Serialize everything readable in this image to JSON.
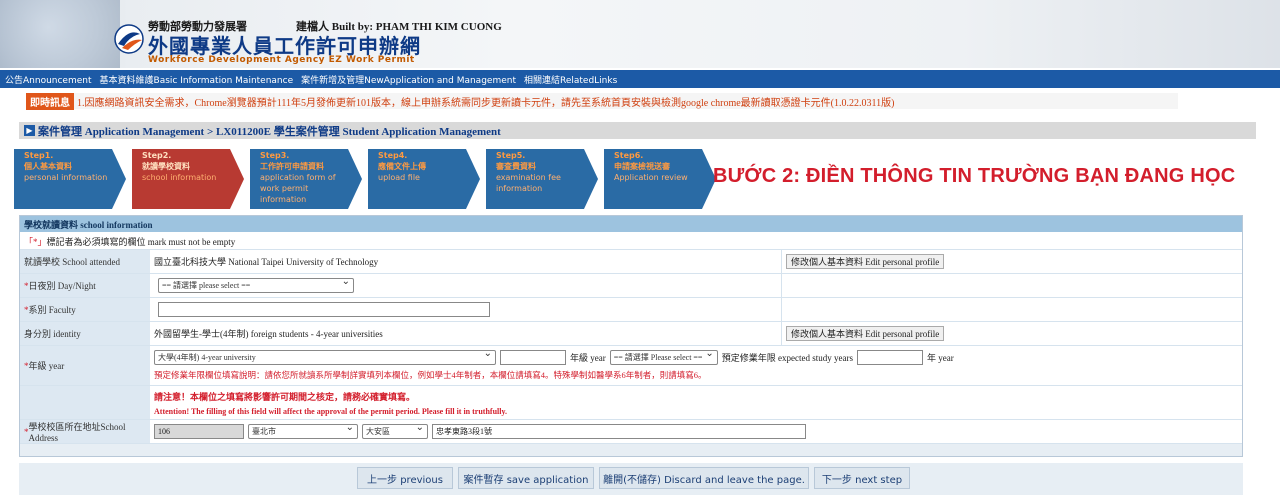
{
  "header": {
    "agency": "勞動部勞動力發展署",
    "builder": "建檔人 Built by: PHAM THI KIM CUONG",
    "title": "外國專業人員工作許可申辦網",
    "subtitle": "Workforce Development Agency EZ Work Permit"
  },
  "nav": {
    "items": [
      "公告Announcement",
      "基本資料維護Basic Information Maintenance",
      "案件新增及管理NewApplication and Management",
      "相關連結RelatedLinks"
    ]
  },
  "notice": {
    "badge": "即時訊息",
    "text": "1.因應網路資訊安全需求，Chrome瀏覽器預計111年5月發佈更新101版本，線上申辦系統需同步更新讀卡元件，請先至系統首頁安裝與檢測google chrome最新讀取憑證卡元件(1.0.22.0311版)"
  },
  "breadcrumb": "案件管理 Application Management > LX011200E 學生案件管理 Student Application Management",
  "steps": [
    {
      "num": "Step1.",
      "zh": "個人基本資料",
      "en": "personal information"
    },
    {
      "num": "Step2.",
      "zh": "就讀學校資料",
      "en": "school information"
    },
    {
      "num": "Step3.",
      "zh": "工作許可申請資料",
      "en": "application form of work permit information"
    },
    {
      "num": "Step4.",
      "zh": "應備文件上傳",
      "en": "upload file"
    },
    {
      "num": "Step5.",
      "zh": "審查費資料",
      "en": "examination fee information"
    },
    {
      "num": "Step6.",
      "zh": "申請案檢視送審",
      "en": "Application review"
    }
  ],
  "overlay_label": "BƯỚC 2: ĐIỀN THÔNG TIN TRƯỜNG BẠN ĐANG HỌC",
  "form": {
    "header": "學校就讀資料 school information",
    "hint_mark": "「*」",
    "hint": "標記者為必須填寫的欄位 mark must not be empty",
    "school_label": "就讀學校 School attended",
    "school_value": "國立臺北科技大學 National Taipei University of Technology",
    "edit_profile": "修改個人基本資料 Edit personal profile",
    "daynight_label": "日夜別 Day/Night",
    "daynight_select": "== 請選擇 please select ==",
    "faculty_label": "系別 Faculty",
    "faculty_value": "",
    "identity_label": "身分別 identity",
    "identity_value": "外國留學生-學士(4年制) foreign students - 4-year universities",
    "year_label": "年級 year",
    "year_type_select": "大學(4年制) 4-year university",
    "year_grade_value": "",
    "year_text": "年級 year",
    "year_please_select": "== 請選擇 Please select ==",
    "expected_label": "預定修業年限 expected study years",
    "expected_value": "",
    "year_unit": "年 year",
    "year_note": "預定修業年限欄位填寫說明：請依您所就讀系所學制詳實填列本欄位，例如學士4年制者，本欄位請填寫4。特殊學制如醫學系6年制者，則請填寫6。",
    "attention_zh": "請注意！本欄位之填寫將影響許可期間之核定，請務必確實填寫。",
    "attention_en": "Attention! The filling of this field will affect the approval of the permit period. Please fill it in truthfully.",
    "address_label": "學校校區所在地址School Address",
    "postal_code": "106",
    "city": "臺北市",
    "district": "大安區",
    "street": "忠孝東路3段1號"
  },
  "buttons": {
    "previous": "上一步 previous",
    "save": "案件暫存 save application",
    "discard": "離開(不儲存) Discard and leave the page.",
    "next": "下一步 next step"
  },
  "colors": {
    "nav_bg": "#1c5aa6",
    "step_blue": "#2a6ba5",
    "step_active": "#b83a32",
    "overlay_red": "#d31e2c"
  }
}
